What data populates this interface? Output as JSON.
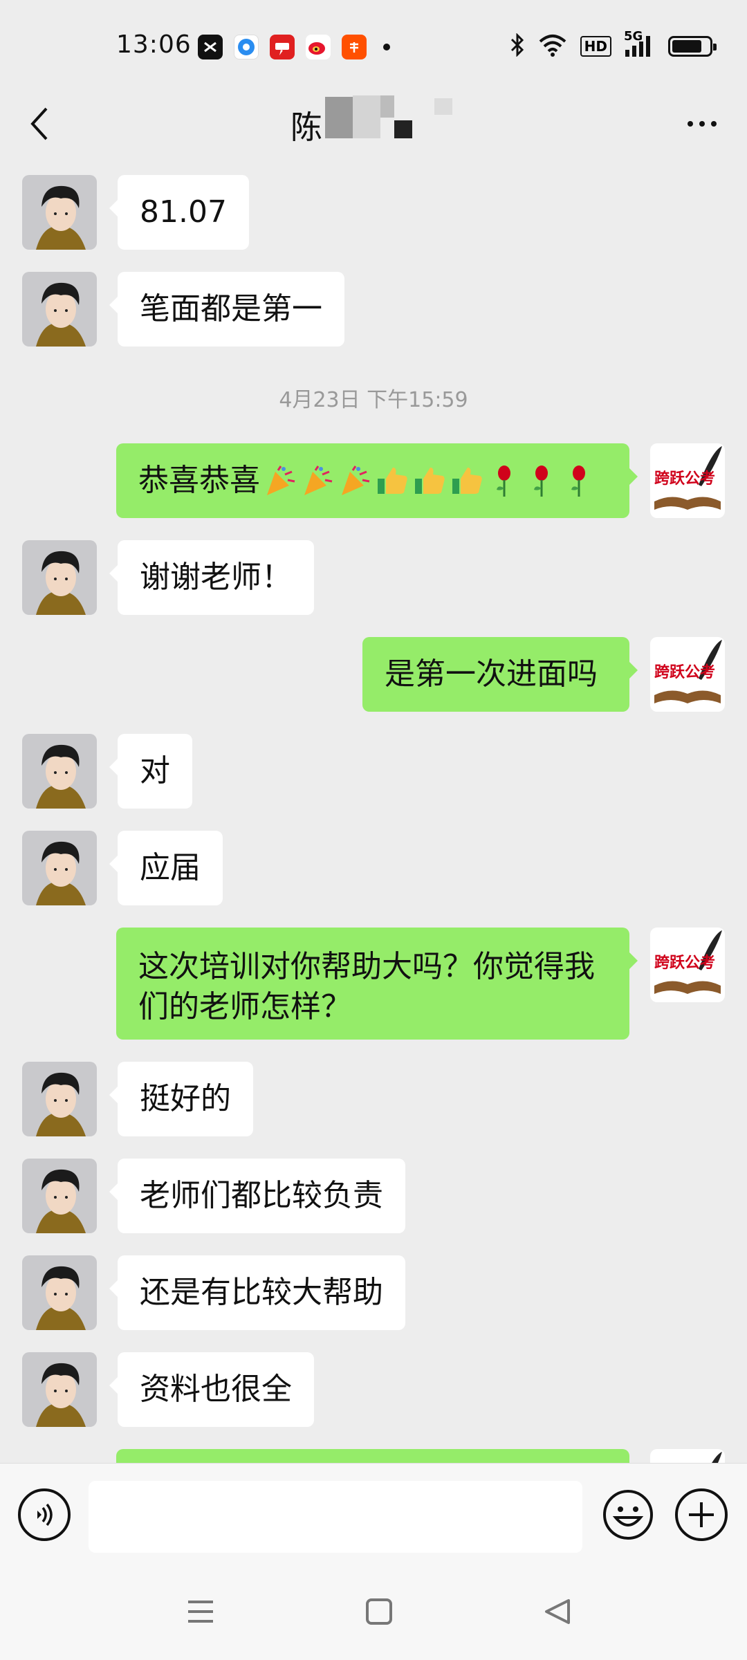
{
  "status_bar": {
    "time": "13:06",
    "app_icons": [
      "capcut-icon",
      "browser-icon",
      "uc-icon",
      "weibo-icon",
      "taobao-icon"
    ],
    "network_badge": "HD",
    "signal_label": "5G"
  },
  "header": {
    "title": "陈",
    "back_icon": "chevron-left-icon",
    "more_icon": "more-dots-icon"
  },
  "chat": {
    "timestamp": "4月23日 下午15:59",
    "messages": [
      {
        "side": "in",
        "text": "81.07"
      },
      {
        "side": "in",
        "text": "笔面都是第一"
      },
      {
        "side": "out",
        "text": "恭喜恭喜",
        "emojis": [
          "party-popper-icon",
          "party-popper-icon",
          "party-popper-icon",
          "thumbs-up-icon",
          "thumbs-up-icon",
          "thumbs-up-icon",
          "rose-icon",
          "rose-icon",
          "rose-icon"
        ]
      },
      {
        "side": "in",
        "text": "谢谢老师！"
      },
      {
        "side": "out",
        "text": "是第一次进面吗"
      },
      {
        "side": "in",
        "text": "对"
      },
      {
        "side": "in",
        "text": "应届"
      },
      {
        "side": "out",
        "text": "这次培训对你帮助大吗？你觉得我们的老师怎样？"
      },
      {
        "side": "in",
        "text": "挺好的"
      },
      {
        "side": "in",
        "text": "老师们都比较负责"
      },
      {
        "side": "in",
        "text": "还是有比较大帮助"
      },
      {
        "side": "in",
        "text": "资料也很全"
      },
      {
        "side": "out",
        "text": ""
      }
    ],
    "self_avatar_text": "跨跃公考"
  },
  "input_bar": {
    "voice_icon": "voice-icon",
    "emoji_icon": "smile-icon",
    "plus_icon": "plus-icon"
  },
  "nav_bar": {
    "menu_icon": "menu-icon",
    "home_icon": "home-square-icon",
    "back_icon": "back-triangle-icon"
  },
  "colors": {
    "background": "#ededed",
    "incoming_bubble": "#ffffff",
    "outgoing_bubble": "#95ec69",
    "timestamp": "#999999",
    "brand_red": "#d0021b"
  }
}
